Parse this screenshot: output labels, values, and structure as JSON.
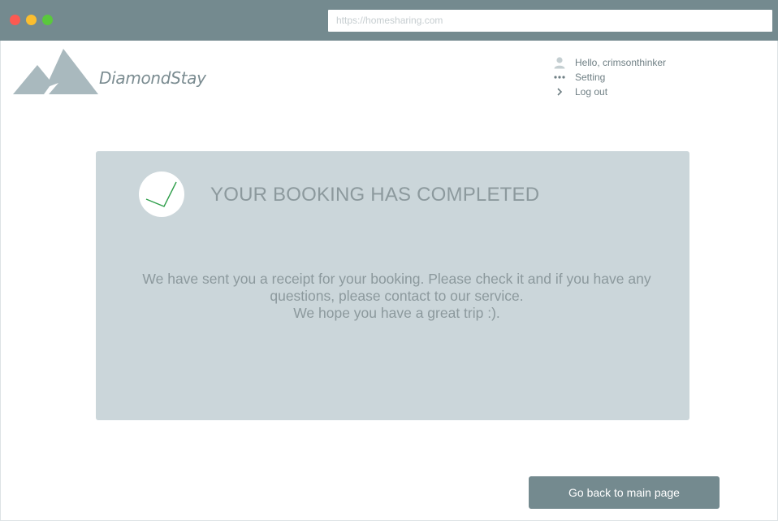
{
  "browser": {
    "url": "https://homesharing.com"
  },
  "header": {
    "brand_name": "DiamondStay"
  },
  "user_menu": {
    "items": [
      {
        "label": "Hello, crimsonthinker",
        "icon": "user-icon"
      },
      {
        "label": "Setting",
        "icon": "more-dots-icon"
      },
      {
        "label": "Log out",
        "icon": "chevron-right-icon"
      }
    ]
  },
  "confirmation": {
    "title": "YOUR BOOKING HAS COMPLETED",
    "message_line1": "We have sent you a receipt for your booking. Please check it and if you have any",
    "message_line2": "questions, please contact to our service.",
    "message_line3": "We hope you have a great trip :)."
  },
  "actions": {
    "back_label": "Go back to main page"
  },
  "colors": {
    "toolbar": "#748a8f",
    "panel": "#cbd6da",
    "check": "#2e9e4a",
    "button": "#748a8f"
  }
}
